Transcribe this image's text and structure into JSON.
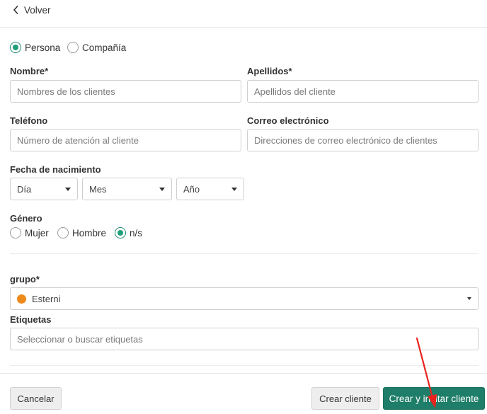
{
  "nav": {
    "back_label": "Volver"
  },
  "type_radio": {
    "options": [
      "Persona",
      "Compañía"
    ],
    "selected": "Persona"
  },
  "name": {
    "label": "Nombre*",
    "placeholder": "Nombres de los clientes",
    "value": ""
  },
  "surname": {
    "label": "Apellidos*",
    "placeholder": "Apellidos del cliente",
    "value": ""
  },
  "phone": {
    "label": "Teléfono",
    "placeholder": "Número de atención al cliente",
    "value": ""
  },
  "email": {
    "label": "Correo electrónico",
    "placeholder": "Direcciones de correo electrónico de clientes",
    "value": ""
  },
  "birth": {
    "label": "Fecha de nacimiento",
    "day": "Día",
    "month": "Mes",
    "year": "Año"
  },
  "gender": {
    "label": "Género",
    "options": [
      "Mujer",
      "Hombre",
      "n/s"
    ],
    "selected": "n/s"
  },
  "group": {
    "label": "grupo*",
    "value": "Esterni",
    "color": "#ee8a1d"
  },
  "tags": {
    "label": "Etiquetas",
    "placeholder": "Seleccionar o buscar etiquetas",
    "value": ""
  },
  "footer": {
    "cancel_label": "Cancelar",
    "create_label": "Crear cliente",
    "create_invite_label": "Crear y invitar cliente"
  },
  "colors": {
    "primary": "#1f7e69",
    "radio_on": "#1f9e7a",
    "annotation_arrow": "#e8231d"
  }
}
